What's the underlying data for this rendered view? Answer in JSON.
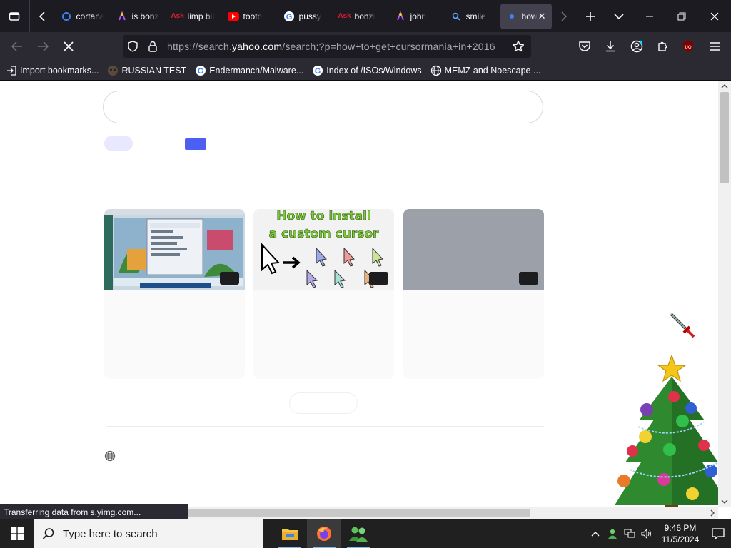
{
  "browser": {
    "tabs": [
      {
        "label": "cortana",
        "favicon": "cortana-icon"
      },
      {
        "label": "is bonzi",
        "favicon": "bonzi-icon"
      },
      {
        "label": "limp bizkit",
        "favicon": "ask-icon"
      },
      {
        "label": "tooto",
        "favicon": "youtube-icon"
      },
      {
        "label": "pussy",
        "favicon": "google-icon"
      },
      {
        "label": "bonzi",
        "favicon": "ask-icon"
      },
      {
        "label": "john",
        "favicon": "bonzi-icon"
      },
      {
        "label": "smile",
        "favicon": "search-icon"
      },
      {
        "label": "how",
        "favicon": "loading-dot",
        "active": true
      }
    ],
    "url_prefix": "https://search.",
    "url_domain": "yahoo.com",
    "url_suffix": "/search;?p=how+to+get+cursormania+in+2016",
    "bookmarks": [
      {
        "label": "Import bookmarks...",
        "icon": "import-icon"
      },
      {
        "label": "RUSSIAN TEST",
        "icon": "mask-icon"
      },
      {
        "label": "Endermanch/Malware...",
        "icon": "google-icon"
      },
      {
        "label": "Index of /ISOs/Windows",
        "icon": "google-icon"
      },
      {
        "label": "MEMZ and Noescape ...",
        "icon": "globe-icon"
      }
    ],
    "status_text": "Transferring data from s.yimg.com..."
  },
  "results": {
    "video_cards": [
      {
        "thumb": "game-screenshot-thumbnail"
      },
      {
        "thumb": "custom-cursor-thumbnail",
        "title_line1": "How to install",
        "title_line2": "a custom cursor"
      },
      {
        "thumb": "gray-placeholder-thumbnail"
      }
    ]
  },
  "taskbar": {
    "search_placeholder": "Type here to search",
    "time": "9:46 PM",
    "date": "11/5/2024"
  },
  "colors": {
    "tabstrip": "#1c1b22",
    "toolbar": "#2b2a33",
    "accent_pill": "#4d5ef2",
    "taskbar": "#202020"
  }
}
